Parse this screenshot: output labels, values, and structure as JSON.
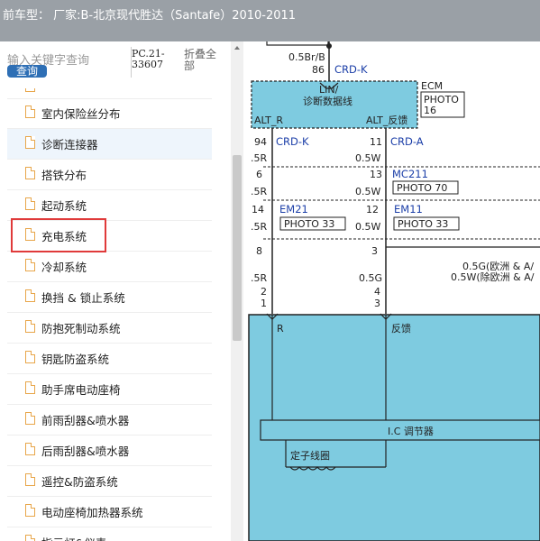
{
  "window": {
    "title": "前车型：  厂家:B-北京现代胜达（Santafe）2010-2011"
  },
  "sidebar": {
    "search_placeholder": "输入关键字查询",
    "query_button": "查询",
    "pc_code": "PC.21-33607",
    "fold_all": "折叠全部",
    "selected_index": 5,
    "items": [
      {
        "label": "室内保险丝分布"
      },
      {
        "label": "诊断连接器"
      },
      {
        "label": "搭铁分布"
      },
      {
        "label": "起动系统"
      },
      {
        "label": "充电系统"
      },
      {
        "label": "冷却系统"
      },
      {
        "label": "换挡 & 锁止系统"
      },
      {
        "label": "防抱死制动系统"
      },
      {
        "label": "钥匙防盗系统"
      },
      {
        "label": "助手席电动座椅"
      },
      {
        "label": "前雨刮器&喷水器"
      },
      {
        "label": "后雨刮器&喷水器"
      },
      {
        "label": "遥控&防盗系统"
      },
      {
        "label": "电动座椅加热器系统"
      },
      {
        "label": "指示灯&仪表"
      }
    ]
  },
  "diagram": {
    "wire_top": "0.5Br/B",
    "pin_86": "86",
    "crd_k_top": "CRD-K",
    "lin_label": "LIN/",
    "lin_sub": "诊断数据线",
    "ecm": "ECM",
    "photo16_a": "PHOTO",
    "photo16_b": "16",
    "alt_r": "ALT_R",
    "alt_fb": "ALT_反馈",
    "pin94": "94",
    "crd_k_left": "CRD-K",
    "pin11": "11",
    "crd_a": "CRD-A",
    "pin6": "6",
    "r5_1": ".5R",
    "pin13": "13",
    "w05_1": "0.5W",
    "mc211": "MC211",
    "photo70": "PHOTO 70",
    "r5_2": ".5R",
    "w05_2": "0.5W",
    "pin14": "14",
    "em21": "EM21",
    "pin12": "12",
    "em11": "EM11",
    "photo33_a": "PHOTO 33",
    "photo33_b": "PHOTO 33",
    "r5_3": ".5R",
    "w05_3": "0.5W",
    "pin8": "8",
    "pin3a": "3",
    "note1": "0.5G(欧洲 & A/",
    "note2": "0.5W(除欧洲 & A/",
    "r5_4": ".5R",
    "g05": "0.5G",
    "pin2": "2",
    "pin4": "4",
    "pin1": "1",
    "pin3b": "3",
    "r_label": "R",
    "fb_label": "反馈",
    "ic_label": "I.C 调节器",
    "stator": "定子线圈"
  },
  "colors": {
    "ecm_fill": "#7ecbe0",
    "alternator_fill": "#7ecbe0",
    "highlight": "#e03a3a",
    "wire_label": "#1c3fa8"
  }
}
